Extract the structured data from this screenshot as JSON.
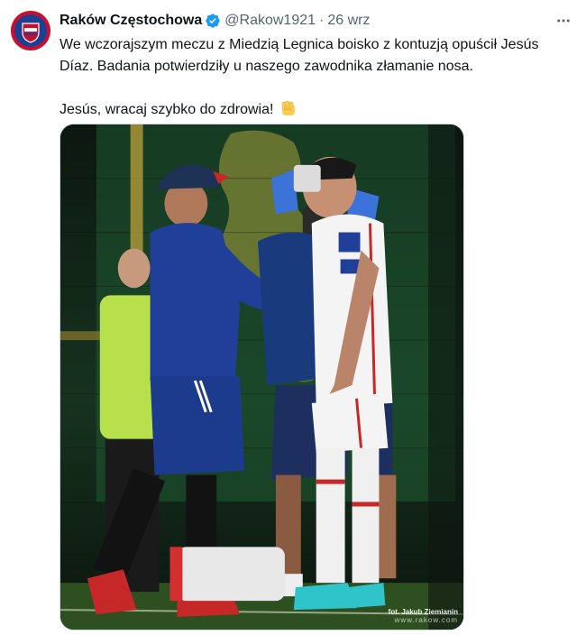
{
  "tweet": {
    "author_name": "Raków Częstochowa",
    "handle": "@Rakow1921",
    "separator": "·",
    "time": "26 wrz",
    "more_icon": "more-horizontal-icon",
    "verified_icon": "verified-badge-icon",
    "text_paragraph_1": "We wczorajszym meczu z Miedzią Legnica boisko z kontuzją opuścił Jesús Díaz. Badania potwierdziły u naszego zawodnika złamanie nosa.",
    "text_paragraph_2": "Jesús, wracaj szybko do zdrowia!",
    "emoji": "✊",
    "media": {
      "credit_line_1": "fot. Jakub Ziemianin",
      "credit_line_2": "www.rakow.com"
    }
  },
  "colors": {
    "accent": "#1d9bf0",
    "secondary_text": "#536471",
    "brand_red": "#c8102e",
    "brand_blue": "#1c3f94"
  }
}
